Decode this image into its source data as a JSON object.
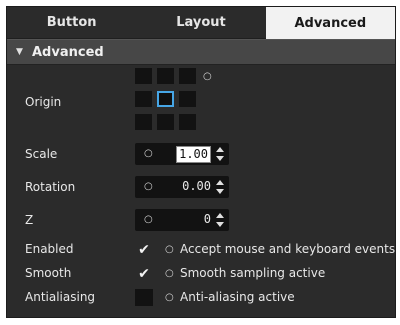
{
  "tabs": [
    {
      "label": "Button",
      "active": false
    },
    {
      "label": "Layout",
      "active": false
    },
    {
      "label": "Advanced",
      "active": true
    }
  ],
  "section": {
    "title": "Advanced",
    "expanded": true
  },
  "origin": {
    "label": "Origin",
    "selected_cell": "center"
  },
  "fields": {
    "scale": {
      "label": "Scale",
      "value": "1.00"
    },
    "rotation": {
      "label": "Rotation",
      "value": "0.00"
    },
    "z": {
      "label": "Z",
      "value": "0"
    }
  },
  "options": {
    "enabled": {
      "label": "Enabled",
      "checked": true,
      "description": "Accept mouse and keyboard events"
    },
    "smooth": {
      "label": "Smooth",
      "checked": true,
      "description": "Smooth sampling active"
    },
    "antialiasing": {
      "label": "Antialiasing",
      "checked": false,
      "description": "Anti-aliasing active"
    }
  },
  "colors": {
    "selection": "#46a6e6",
    "panel": "#2b2b2b",
    "active_tab": "#f2f2f2"
  }
}
